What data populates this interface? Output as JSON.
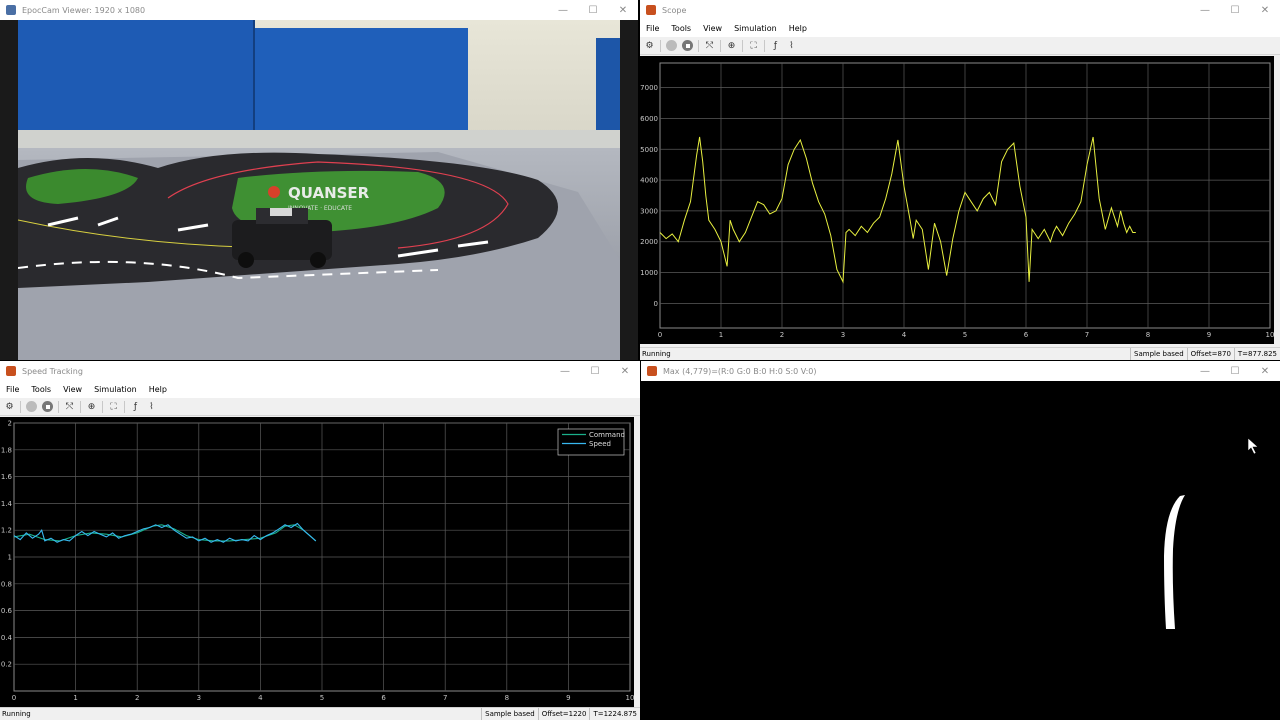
{
  "camera": {
    "title": "EpocCam Viewer: 1920 x 1080",
    "logo_text": "QUANSER",
    "logo_subtext": "INNOVATE · EDUCATE"
  },
  "scope": {
    "title": "Scope",
    "menu": [
      "File",
      "Tools",
      "View",
      "Simulation",
      "Help"
    ],
    "status": "Running",
    "sample": "Sample based",
    "offset": "Offset=870",
    "time": "T=877.825"
  },
  "speed": {
    "title": "Speed Tracking",
    "menu": [
      "File",
      "Tools",
      "View",
      "Simulation",
      "Help"
    ],
    "status": "Running",
    "sample": "Sample based",
    "offset": "Offset=1220",
    "time": "T=1224.875"
  },
  "max": {
    "title": "Max (4,779)=(R:0 G:0 B:0 H:0 S:0 V:0)"
  },
  "window_controls": {
    "minimize": "—",
    "maximize": "☐",
    "close": "✕"
  },
  "colors": {
    "scope_line": "#e8f040",
    "command_line": "#1ab08a",
    "speed_line": "#38b8f0",
    "grid": "#5a5a5a"
  },
  "chart_data": [
    {
      "type": "line",
      "title": "",
      "xlabel": "",
      "ylabel": "",
      "xlim": [
        0,
        10
      ],
      "ylim": [
        -800,
        7800
      ],
      "x_ticks": [
        0,
        1,
        2,
        3,
        4,
        5,
        6,
        7,
        8,
        9,
        10
      ],
      "y_ticks": [
        0,
        1000,
        2000,
        3000,
        4000,
        5000,
        6000,
        7000
      ],
      "grid": true,
      "series": [
        {
          "x": [
            0,
            0.1,
            0.2,
            0.3,
            0.4,
            0.5,
            0.6,
            0.65,
            0.7,
            0.75,
            0.8,
            0.9,
            1.0,
            1.1,
            1.15,
            1.2,
            1.3,
            1.4,
            1.5,
            1.6,
            1.7,
            1.8,
            1.9,
            2.0,
            2.1,
            2.2,
            2.3,
            2.4,
            2.5,
            2.6,
            2.7,
            2.8,
            2.9,
            3.0,
            3.05,
            3.1,
            3.2,
            3.3,
            3.4,
            3.5,
            3.6,
            3.7,
            3.8,
            3.9,
            4.0,
            4.1,
            4.15,
            4.2,
            4.3,
            4.4,
            4.5,
            4.6,
            4.7,
            4.8,
            4.9,
            5.0,
            5.1,
            5.2,
            5.3,
            5.4,
            5.5,
            5.6,
            5.7,
            5.8,
            5.9,
            6.0,
            6.05,
            6.1,
            6.2,
            6.3,
            6.4,
            6.45,
            6.5,
            6.6,
            6.7,
            6.8,
            6.9,
            7.0,
            7.1,
            7.2,
            7.3,
            7.4,
            7.5,
            7.55,
            7.6,
            7.65,
            7.7,
            7.75,
            7.8
          ],
          "y": [
            2300,
            2100,
            2250,
            2000,
            2700,
            3300,
            4800,
            5400,
            4600,
            3500,
            2700,
            2400,
            2000,
            1200,
            2700,
            2400,
            2000,
            2300,
            2800,
            3300,
            3200,
            2900,
            3000,
            3400,
            4500,
            5000,
            5300,
            4700,
            3900,
            3300,
            2900,
            2200,
            1100,
            700,
            2300,
            2400,
            2200,
            2500,
            2300,
            2600,
            2800,
            3400,
            4200,
            5300,
            3800,
            2700,
            2100,
            2700,
            2400,
            1100,
            2600,
            2000,
            900,
            2100,
            3000,
            3600,
            3300,
            3000,
            3400,
            3600,
            3200,
            4600,
            5000,
            5200,
            3800,
            2800,
            700,
            2400,
            2100,
            2400,
            2000,
            2300,
            2500,
            2200,
            2600,
            2900,
            3300,
            4500,
            5400,
            3400,
            2400,
            3100,
            2500,
            3000,
            2600,
            2300,
            2500,
            2300,
            2300
          ]
        }
      ]
    },
    {
      "type": "line",
      "title": "",
      "xlabel": "",
      "ylabel": "",
      "xlim": [
        0,
        10
      ],
      "ylim": [
        0,
        2
      ],
      "x_ticks": [
        0,
        1,
        2,
        3,
        4,
        5,
        6,
        7,
        8,
        9,
        10
      ],
      "y_ticks": [
        0.2,
        0.4,
        0.6,
        0.8,
        1,
        1.2,
        1.4,
        1.6,
        1.8,
        2
      ],
      "grid": true,
      "legend": "top-right",
      "series": [
        {
          "name": "Command",
          "x": [
            0,
            0.25,
            0.5,
            0.75,
            1.0,
            1.25,
            1.5,
            1.75,
            2.0,
            2.25,
            2.4,
            2.6,
            2.8,
            3.0,
            3.25,
            3.5,
            3.75,
            4.0,
            4.25,
            4.4,
            4.55,
            4.7,
            4.9
          ],
          "y": [
            1.15,
            1.17,
            1.13,
            1.12,
            1.16,
            1.18,
            1.17,
            1.15,
            1.18,
            1.23,
            1.24,
            1.21,
            1.16,
            1.13,
            1.12,
            1.12,
            1.13,
            1.14,
            1.18,
            1.23,
            1.24,
            1.2,
            1.12
          ]
        },
        {
          "name": "Speed",
          "x": [
            0,
            0.1,
            0.2,
            0.3,
            0.4,
            0.45,
            0.5,
            0.6,
            0.7,
            0.8,
            0.9,
            1.0,
            1.1,
            1.2,
            1.3,
            1.4,
            1.5,
            1.6,
            1.7,
            1.8,
            1.9,
            2.0,
            2.1,
            2.2,
            2.3,
            2.4,
            2.5,
            2.6,
            2.7,
            2.8,
            2.9,
            3.0,
            3.1,
            3.2,
            3.3,
            3.4,
            3.5,
            3.6,
            3.7,
            3.8,
            3.9,
            4.0,
            4.1,
            4.2,
            4.3,
            4.4,
            4.5,
            4.6,
            4.7,
            4.8,
            4.9
          ],
          "y": [
            1.16,
            1.13,
            1.18,
            1.14,
            1.17,
            1.2,
            1.12,
            1.14,
            1.11,
            1.13,
            1.12,
            1.16,
            1.19,
            1.16,
            1.19,
            1.17,
            1.15,
            1.18,
            1.14,
            1.16,
            1.17,
            1.19,
            1.21,
            1.22,
            1.24,
            1.22,
            1.24,
            1.2,
            1.17,
            1.14,
            1.15,
            1.12,
            1.14,
            1.11,
            1.13,
            1.11,
            1.14,
            1.12,
            1.13,
            1.12,
            1.16,
            1.13,
            1.16,
            1.18,
            1.21,
            1.24,
            1.22,
            1.25,
            1.2,
            1.16,
            1.12
          ]
        }
      ]
    }
  ]
}
